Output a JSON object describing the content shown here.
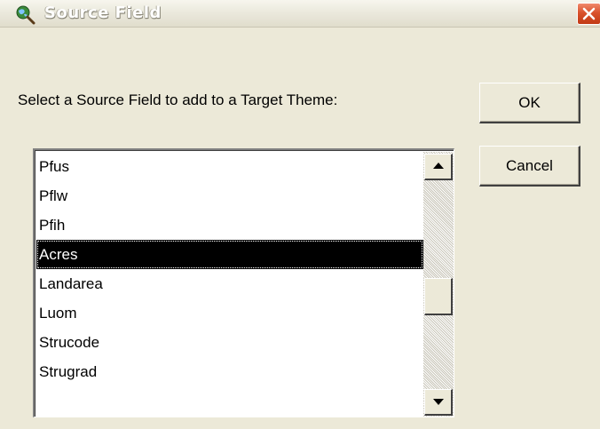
{
  "window": {
    "title": "Source Field",
    "icon": "globe-magnifier-icon",
    "close_icon": "close-icon"
  },
  "dialog": {
    "prompt": "Select a Source Field to add to a Target Theme:",
    "ok_label": "OK",
    "cancel_label": "Cancel"
  },
  "field_list": {
    "items": [
      "Pfus",
      "Pflw",
      "Pfih",
      "Acres",
      "Landarea",
      "Luom",
      "Strucode",
      "Strugrad"
    ],
    "selected": "Acres"
  },
  "colors": {
    "selection_bg": "#000000",
    "close_button": "#d9522c",
    "dialog_bg": "#ece9d8"
  }
}
